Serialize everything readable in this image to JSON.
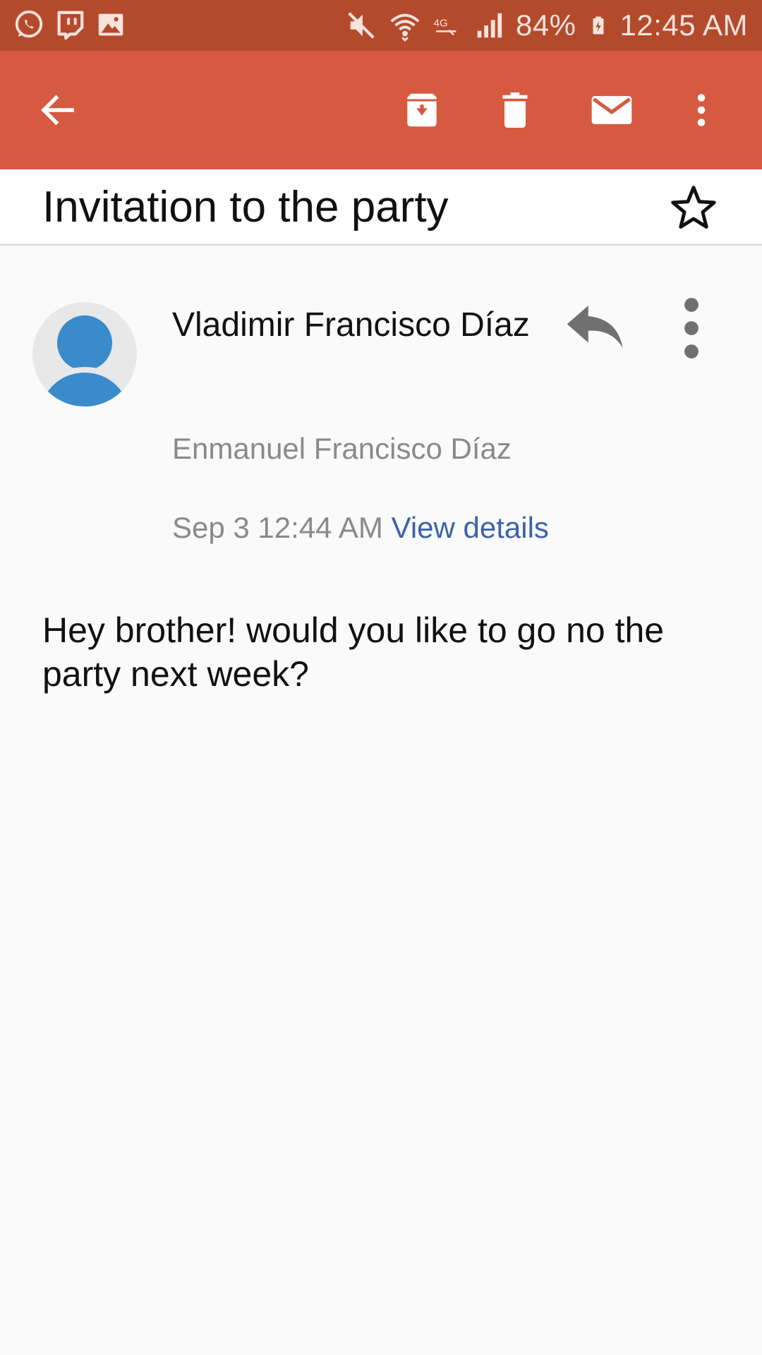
{
  "status_bar": {
    "battery": "84%",
    "time": "12:45 AM",
    "left_icons": [
      "whatsapp-icon",
      "twitch-icon",
      "image-icon"
    ],
    "right_icons": [
      "mute-icon",
      "wifi-icon",
      "lte-icon",
      "signal-icon",
      "battery-charging-icon"
    ]
  },
  "toolbar": {
    "icons": [
      "back-arrow-icon",
      "archive-icon",
      "delete-icon",
      "mail-icon",
      "more-vert-icon"
    ]
  },
  "email": {
    "subject": "Invitation to the party",
    "sender": "Vladimir Francisco Díaz",
    "recipient": "Enmanuel Francisco Díaz",
    "date": "Sep 3 12:44 AM",
    "view_details": "View details",
    "body": "Hey brother! would you like to go no the party next week?"
  },
  "colors": {
    "status_bar": "#b44a2c",
    "app_bar": "#d65a40",
    "link": "#3c62ad",
    "avatar": "#3a8bcb"
  }
}
